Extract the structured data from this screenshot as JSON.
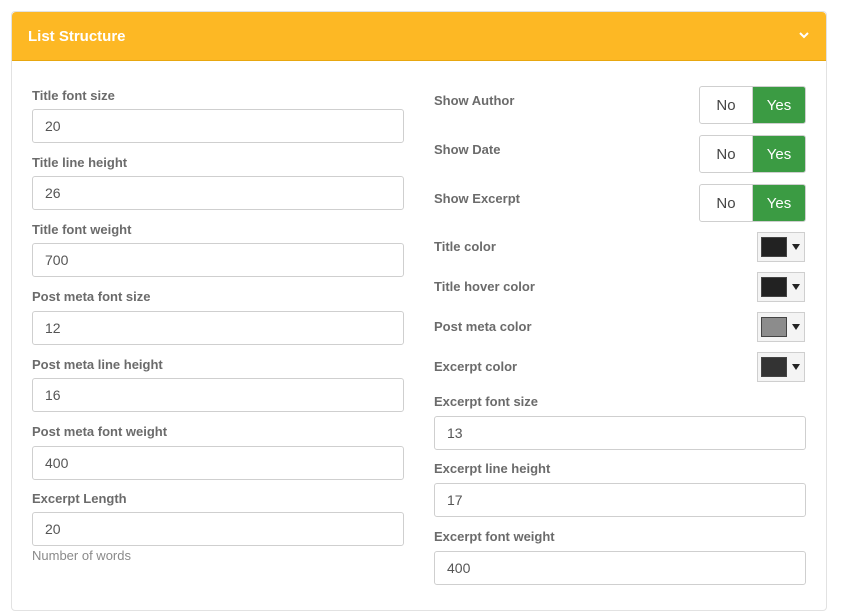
{
  "panel": {
    "title": "List Structure"
  },
  "left_fields": [
    {
      "label": "Title font size",
      "value": "20"
    },
    {
      "label": "Title line height",
      "value": "26"
    },
    {
      "label": "Title font weight",
      "value": "700"
    },
    {
      "label": "Post meta font size",
      "value": "12"
    },
    {
      "label": "Post meta line height",
      "value": "16"
    },
    {
      "label": "Post meta font weight",
      "value": "400"
    },
    {
      "label": "Excerpt Length",
      "value": "20",
      "help": "Number of words"
    }
  ],
  "toggles": [
    {
      "label": "Show Author",
      "no": "No",
      "yes": "Yes",
      "selected": "Yes"
    },
    {
      "label": "Show Date",
      "no": "No",
      "yes": "Yes",
      "selected": "Yes"
    },
    {
      "label": "Show Excerpt",
      "no": "No",
      "yes": "Yes",
      "selected": "Yes"
    }
  ],
  "colors": [
    {
      "label": "Title color",
      "swatch": "#222222"
    },
    {
      "label": "Title hover color",
      "swatch": "#222222"
    },
    {
      "label": "Post meta color",
      "swatch": "#8c8c8c"
    },
    {
      "label": "Excerpt color",
      "swatch": "#333333"
    }
  ],
  "right_fields": [
    {
      "label": "Excerpt font size",
      "value": "13"
    },
    {
      "label": "Excerpt line height",
      "value": "17"
    },
    {
      "label": "Excerpt font weight",
      "value": "400"
    }
  ]
}
